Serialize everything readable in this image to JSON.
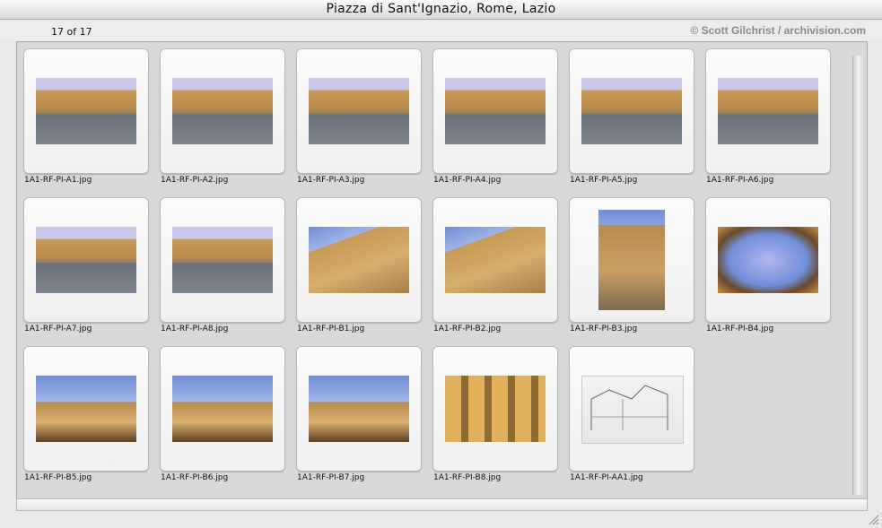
{
  "window": {
    "title": "Piazza di Sant'Ignazio, Rome, Lazio"
  },
  "info": {
    "count": "17 of 17",
    "copyright": "© Scott Gilchrist / archivision.com"
  },
  "thumbnails": [
    {
      "caption": "1A1-RF-PI-A1.jpg",
      "kind": "wide-piazza"
    },
    {
      "caption": "1A1-RF-PI-A2.jpg",
      "kind": "wide-piazza"
    },
    {
      "caption": "1A1-RF-PI-A3.jpg",
      "kind": "wide-piazza"
    },
    {
      "caption": "1A1-RF-PI-A4.jpg",
      "kind": "wide-piazza"
    },
    {
      "caption": "1A1-RF-PI-A5.jpg",
      "kind": "wide-piazza"
    },
    {
      "caption": "1A1-RF-PI-A6.jpg",
      "kind": "wide-piazza"
    },
    {
      "caption": "1A1-RF-PI-A7.jpg",
      "kind": "wide-piazza"
    },
    {
      "caption": "1A1-RF-PI-A8.jpg",
      "kind": "wide-piazza"
    },
    {
      "caption": "1A1-RF-PI-B1.jpg",
      "kind": "facade-sky"
    },
    {
      "caption": "1A1-RF-PI-B2.jpg",
      "kind": "facade-sky"
    },
    {
      "caption": "1A1-RF-PI-B3.jpg",
      "kind": "portrait-facade"
    },
    {
      "caption": "1A1-RF-PI-B4.jpg",
      "kind": "upward-sky"
    },
    {
      "caption": "1A1-RF-PI-B5.jpg",
      "kind": "cornice-sky"
    },
    {
      "caption": "1A1-RF-PI-B6.jpg",
      "kind": "cornice-sky"
    },
    {
      "caption": "1A1-RF-PI-B7.jpg",
      "kind": "cornice-sky"
    },
    {
      "caption": "1A1-RF-PI-B8.jpg",
      "kind": "window-wall"
    },
    {
      "caption": "1A1-RF-PI-AA1.jpg",
      "kind": "plan-drawing"
    }
  ],
  "colors": {
    "sky": "#c9c7ee",
    "ochre": "#c89a55",
    "pavement": "#6b6f79",
    "blue_sky": "#6f8ed8"
  }
}
